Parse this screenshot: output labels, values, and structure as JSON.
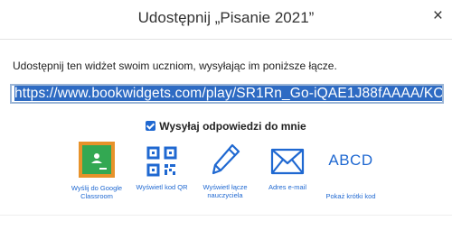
{
  "dialog": {
    "title": "Udostępnij „Pisanie 2021”",
    "close_glyph": "×"
  },
  "description": "Udostępnij ten widżet swoim uczniom, wysyłając im poniższe łącze.",
  "share_url": "https://www.bookwidgets.com/play/SR1Rn_Go-iQAE1J88fAAAA/KC",
  "checkbox": {
    "label": "Wysyłaj odpowiedzi do mnie",
    "checked": true
  },
  "options": [
    {
      "label_line1": "Wyślij do Google",
      "label_line2": "Classroom",
      "icon": "google-classroom-icon"
    },
    {
      "label_line1": "Wyświetl kod QR",
      "label_line2": "",
      "icon": "qr-code-icon"
    },
    {
      "label_line1": "Wyświetl łącze",
      "label_line2": "nauczyciela",
      "icon": "pencil-icon"
    },
    {
      "label_line1": "Adres e-mail",
      "label_line2": "",
      "icon": "envelope-icon"
    },
    {
      "label_line1": "Pokaż krótki kod",
      "label_line2": "",
      "icon": "short-code-icon",
      "icon_text": "ABCD"
    }
  ],
  "colors": {
    "accent": "#1f68d1",
    "selection": "#2e6bc3",
    "google_classroom_green": "#33a852",
    "google_classroom_border": "#e7922a"
  }
}
